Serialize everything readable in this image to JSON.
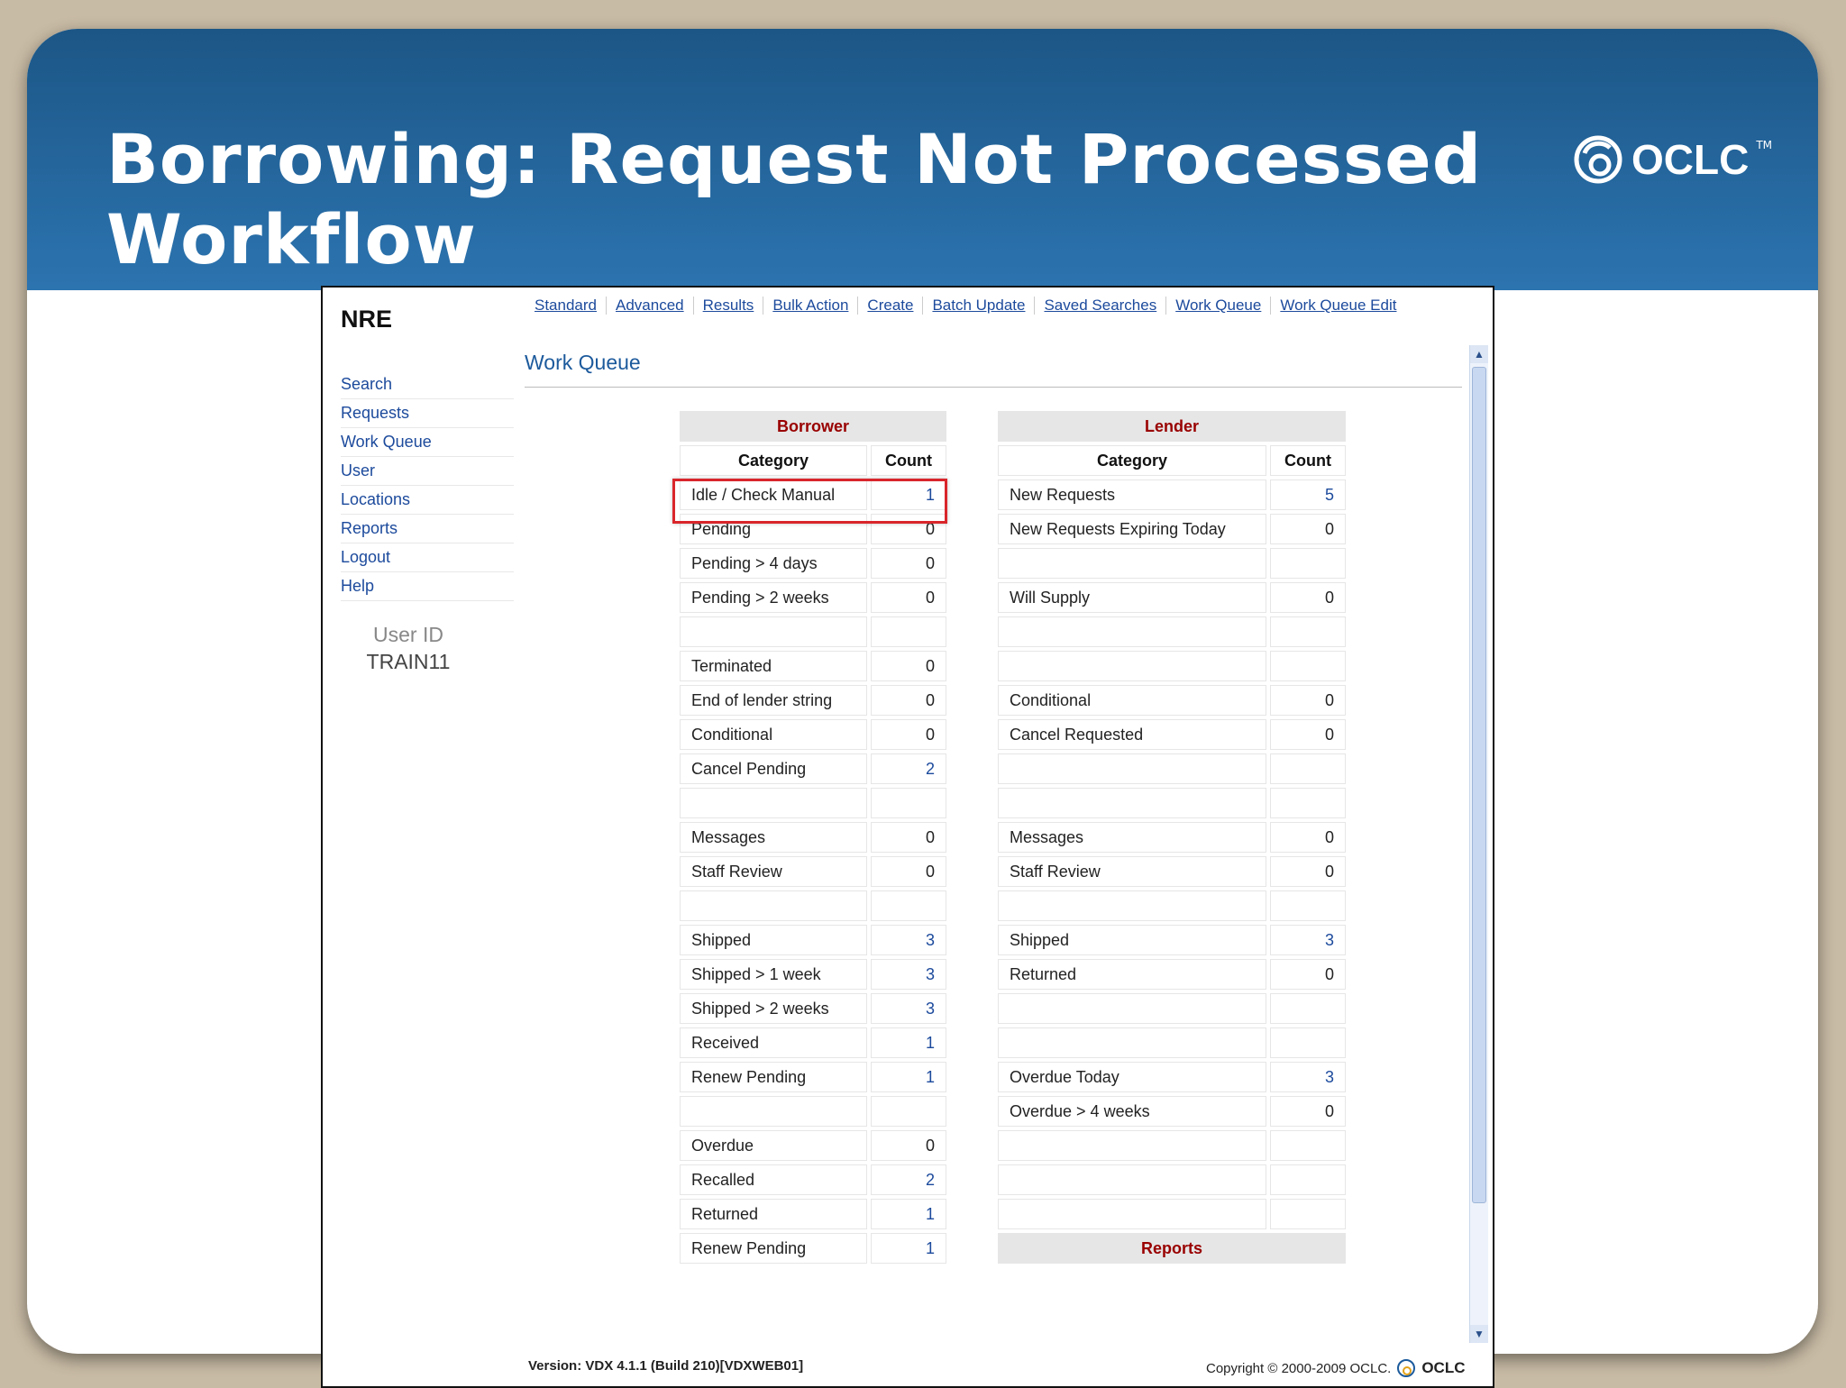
{
  "slide": {
    "title": "Borrowing: Request Not Processed Workflow",
    "brand": "OCLC",
    "brand_mark": "TM"
  },
  "app": {
    "logo": "NRE",
    "topnav": [
      "Standard",
      "Advanced",
      "Results",
      "Bulk Action",
      "Create",
      "Batch Update",
      "Saved Searches",
      "Work Queue",
      "Work Queue Edit"
    ],
    "sidenav": [
      "Search",
      "Requests",
      "Work Queue",
      "User",
      "Locations",
      "Reports",
      "Logout",
      "Help"
    ],
    "user_label": "User ID",
    "user_value": "TRAIN11",
    "page_title": "Work Queue"
  },
  "borrower": {
    "title": "Borrower",
    "col_category": "Category",
    "col_count": "Count",
    "rows": [
      {
        "category": "Idle / Check Manual",
        "count": "1",
        "link": true
      },
      {
        "category": "Pending",
        "count": "0",
        "link": false
      },
      {
        "category": "Pending > 4 days",
        "count": "0",
        "link": false
      },
      {
        "category": "Pending > 2 weeks",
        "count": "0",
        "link": false
      },
      {
        "category": "",
        "count": "",
        "link": false
      },
      {
        "category": "Terminated",
        "count": "0",
        "link": false
      },
      {
        "category": "End of lender string",
        "count": "0",
        "link": false
      },
      {
        "category": "Conditional",
        "count": "0",
        "link": false
      },
      {
        "category": "Cancel Pending",
        "count": "2",
        "link": true
      },
      {
        "category": "",
        "count": "",
        "link": false
      },
      {
        "category": "Messages",
        "count": "0",
        "link": false
      },
      {
        "category": "Staff Review",
        "count": "0",
        "link": false
      },
      {
        "category": "",
        "count": "",
        "link": false
      },
      {
        "category": "Shipped",
        "count": "3",
        "link": true
      },
      {
        "category": "Shipped > 1 week",
        "count": "3",
        "link": true
      },
      {
        "category": "Shipped > 2 weeks",
        "count": "3",
        "link": true
      },
      {
        "category": "Received",
        "count": "1",
        "link": true
      },
      {
        "category": "Renew Pending",
        "count": "1",
        "link": true
      },
      {
        "category": "",
        "count": "",
        "link": false
      },
      {
        "category": "Overdue",
        "count": "0",
        "link": false
      },
      {
        "category": "Recalled",
        "count": "2",
        "link": true
      },
      {
        "category": "Returned",
        "count": "1",
        "link": true
      },
      {
        "category": "Renew Pending",
        "count": "1",
        "link": true
      }
    ]
  },
  "lender": {
    "title": "Lender",
    "col_category": "Category",
    "col_count": "Count",
    "rows": [
      {
        "category": "New Requests",
        "count": "5",
        "link": true
      },
      {
        "category": "New Requests Expiring Today",
        "count": "0",
        "link": false
      },
      {
        "category": "",
        "count": "",
        "link": false
      },
      {
        "category": "Will Supply",
        "count": "0",
        "link": false
      },
      {
        "category": "",
        "count": "",
        "link": false
      },
      {
        "category": "",
        "count": "",
        "link": false
      },
      {
        "category": "Conditional",
        "count": "0",
        "link": false
      },
      {
        "category": "Cancel Requested",
        "count": "0",
        "link": false
      },
      {
        "category": "",
        "count": "",
        "link": false
      },
      {
        "category": "",
        "count": "",
        "link": false
      },
      {
        "category": "Messages",
        "count": "0",
        "link": false
      },
      {
        "category": "Staff Review",
        "count": "0",
        "link": false
      },
      {
        "category": "",
        "count": "",
        "link": false
      },
      {
        "category": "Shipped",
        "count": "3",
        "link": true
      },
      {
        "category": "Returned",
        "count": "0",
        "link": false
      },
      {
        "category": "",
        "count": "",
        "link": false
      },
      {
        "category": "",
        "count": "",
        "link": false
      },
      {
        "category": "Overdue Today",
        "count": "3",
        "link": true
      },
      {
        "category": "Overdue > 4 weeks",
        "count": "0",
        "link": false
      },
      {
        "category": "",
        "count": "",
        "link": false
      },
      {
        "category": "",
        "count": "",
        "link": false
      },
      {
        "category": "",
        "count": "",
        "link": false
      }
    ],
    "reports_label": "Reports"
  },
  "footer": {
    "version": "Version: VDX 4.1.1 (Build 210)[VDXWEB01]",
    "copyright": "Copyright © 2000-2009 OCLC.",
    "brand": "OCLC"
  },
  "colors": {
    "banner": "#1c5686",
    "link": "#1c4a9c",
    "header_text": "#990000",
    "highlight": "#d9262b"
  }
}
